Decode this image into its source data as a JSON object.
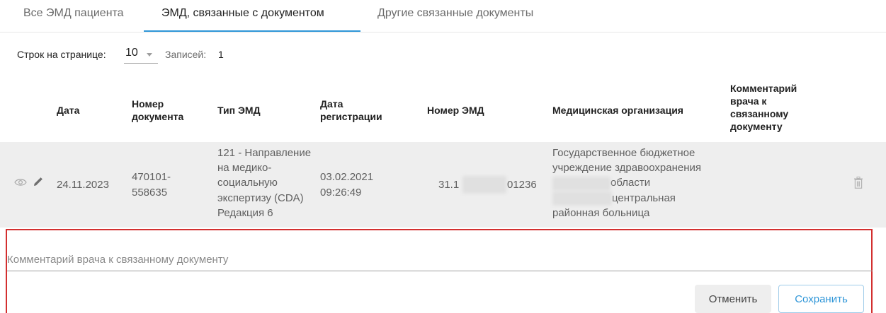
{
  "tabs": [
    {
      "label": "Все ЭМД пациента",
      "active": false
    },
    {
      "label": "ЭМД, связанные с документом",
      "active": true
    },
    {
      "label": "Другие связанные документы",
      "active": false
    }
  ],
  "pager": {
    "rows_label": "Строк на странице:",
    "rows_value": "10",
    "count_label": "Записей:",
    "count_value": "1"
  },
  "table": {
    "headers": {
      "date": "Дата",
      "doc_number": [
        "Номер",
        "документа"
      ],
      "emd_type": "Тип ЭМД",
      "reg_date": [
        "Дата",
        "регистрации"
      ],
      "emd_number": "Номер ЭМД",
      "organization": "Медицинская организация",
      "comment": [
        "Комментарий",
        "врача к",
        "связанному",
        "документу"
      ]
    },
    "rows": [
      {
        "date": "24.11.2023",
        "doc_number": [
          "470101-",
          "558635"
        ],
        "emd_type": [
          "121 - Направление",
          "на медико-",
          "социальную",
          "экспертизу (CDA)",
          "Редакция 6"
        ],
        "reg_date": [
          "03.02.2021",
          "09:26:49"
        ],
        "emd_number": {
          "prefix": "31.1",
          "suffix": "01236"
        },
        "organization": [
          "Государственное бюджетное",
          "учреждение здравоохранения",
          "области",
          "центральная",
          "районная больница"
        ],
        "comment": ""
      }
    ]
  },
  "editor": {
    "comment_placeholder": "Комментарий врача к связанному документу",
    "cancel_label": "Отменить",
    "save_label": "Сохранить"
  },
  "icons": {
    "view": "eye-icon",
    "edit": "pencil-icon",
    "delete": "trash-icon",
    "select_caret": "caret-down-icon"
  },
  "colors": {
    "accent": "#2f96d8",
    "highlight_border": "#d32f2f",
    "row_background": "#eeeeee"
  }
}
